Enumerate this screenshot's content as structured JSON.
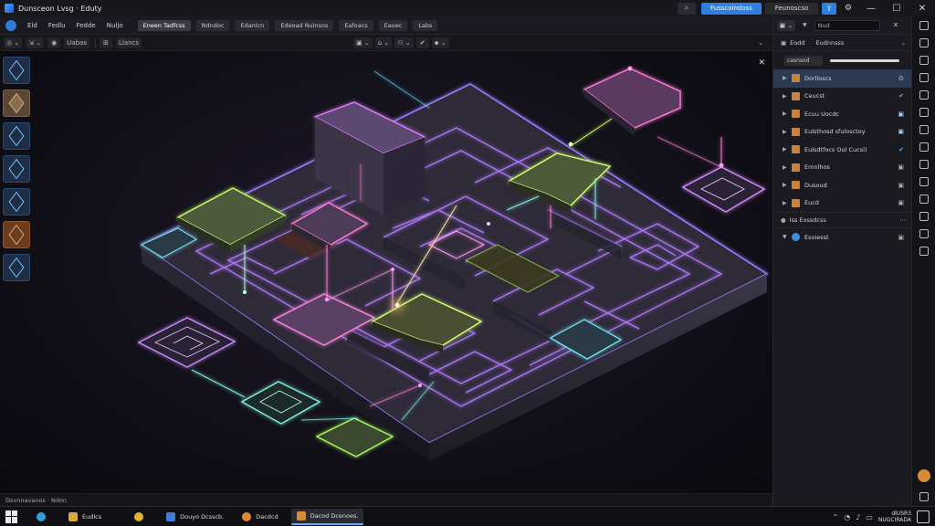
{
  "titlebar": {
    "title": "Dunsceon Lvsg · Eduty",
    "primary_button": "Fusscoindoss",
    "secondary_button": "Feunoscso",
    "search_icon": "search-icon",
    "window": {
      "minimize": "—",
      "maximize": "☐",
      "close": "✕"
    }
  },
  "menubar": {
    "items": [
      "Eld",
      "Fedlu",
      "Fedde",
      "Nuljo"
    ],
    "tabs": [
      "Eneen Tadfcss",
      "Ndndoc",
      "Edanlcn",
      "Edeoad Nulnsos",
      "Eafoacs",
      "Eaoec",
      "Labs"
    ],
    "active_tab": 0
  },
  "toolbar": {
    "left": [
      "◎ ⌄",
      "⇲ ⌄",
      "◉",
      "Uabas",
      "⊞",
      "Llancs"
    ],
    "mid": [
      "▣ ⌄",
      "⌂ ⌄",
      "⚇ ⌄",
      "✔",
      "⬥ ⌄"
    ],
    "right": "⌄"
  },
  "viewport": {
    "close_icon": "✕"
  },
  "palette": {
    "items": [
      "cube-blue-icon",
      "crate-icon",
      "info-cube-icon",
      "cube-outline-icon",
      "cube-outline-icon",
      "brown-cube-icon",
      "cube-outline-icon"
    ]
  },
  "status": {
    "text": "Dsvnnavanos · Ndon"
  },
  "rpanel": {
    "dropdown": "▣ ⌄",
    "search_value": "Nud",
    "header_left": "Eodd",
    "header_mid": "Eudnnsss",
    "filter_label": "casnsod",
    "tree": [
      {
        "label": "Dorlloscs",
        "right": "⚙",
        "selected": true
      },
      {
        "label": "Ceucst",
        "right": "✔"
      },
      {
        "label": "Ecuu Uocdc",
        "right": "▣"
      },
      {
        "label": "Eulsthosd sfulosctoy",
        "right": "▣"
      },
      {
        "label": "Eulsdtfocs Oul Cucsi)",
        "right": "✔"
      },
      {
        "label": "Emnlhos",
        "right": "▣"
      },
      {
        "label": "Dusoud",
        "right": "▣"
      },
      {
        "label": "Eucd",
        "right": "▣"
      }
    ],
    "section2_label": "Iss Eossdcss",
    "section2_item": "Esoiesst"
  },
  "taskbar": {
    "apps": [
      {
        "label": "Eudlcs",
        "color": "#d9a93a"
      },
      {
        "label": "",
        "color": "#2f7fe0"
      },
      {
        "label": "Douyo Dcsscb.",
        "color": "#3d7ed8"
      },
      {
        "label": "Dacdcd",
        "color": "#e0892f"
      },
      {
        "label": "Dacod Dcenoes.",
        "color": "#d88b3a",
        "active": true
      }
    ],
    "time": "dlUSR3",
    "date": "NUGCIRADA"
  },
  "colors": {
    "accent": "#2f7fe0",
    "neon_purple": "#b46bff",
    "neon_pink": "#ff5fd4",
    "neon_green": "#b7ff6a",
    "neon_cyan": "#5ff0ff"
  }
}
